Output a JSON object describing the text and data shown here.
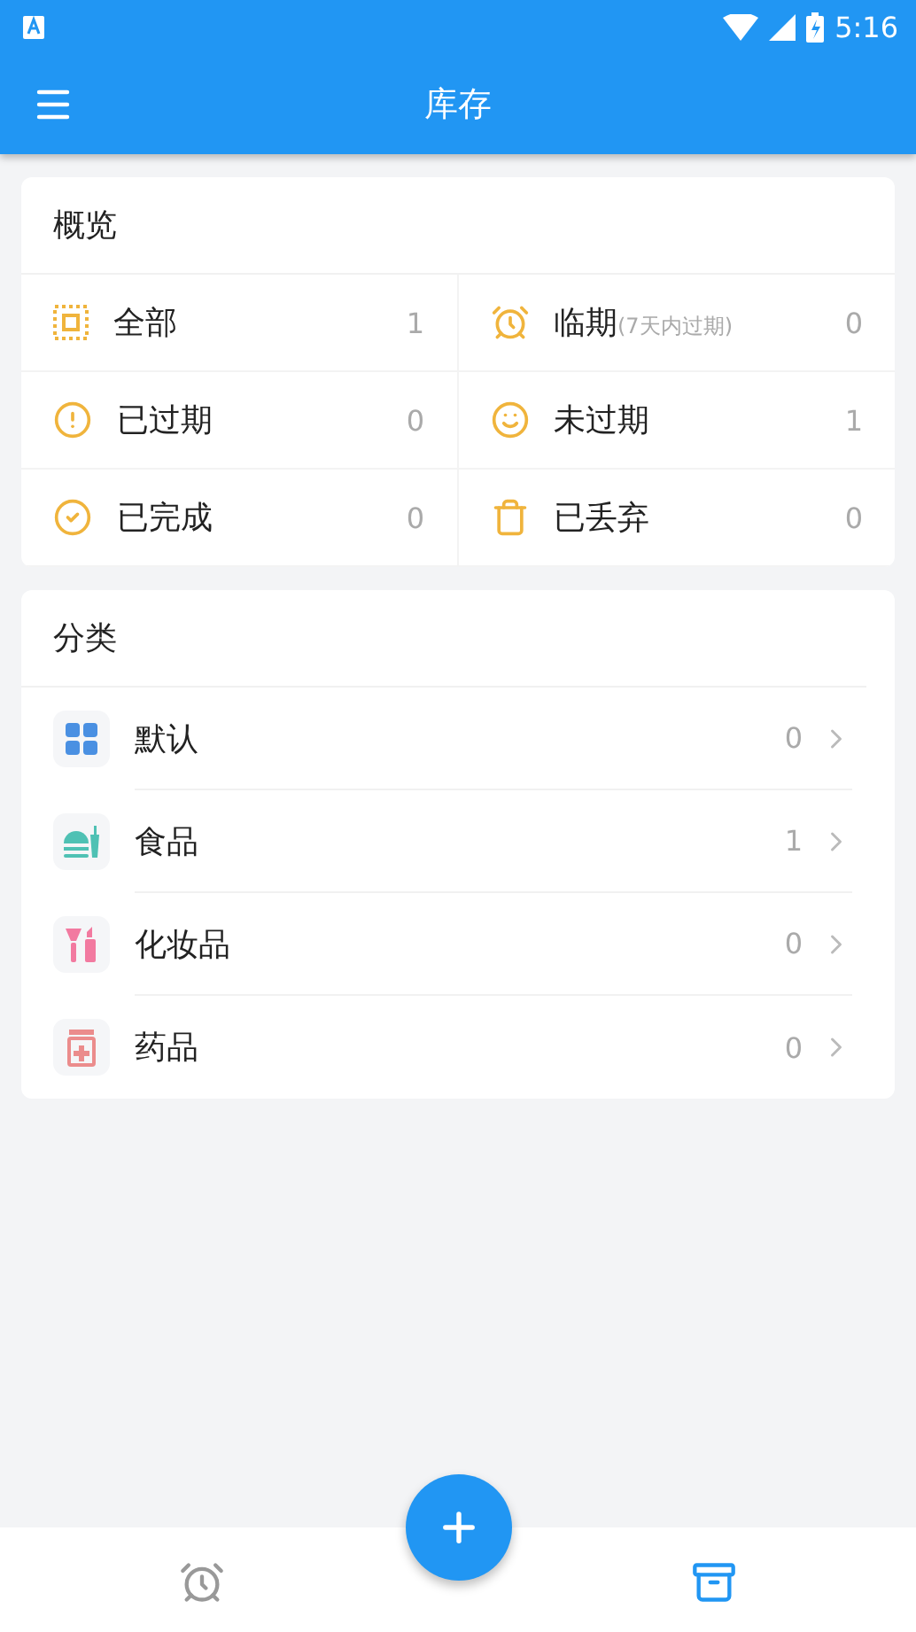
{
  "status_bar": {
    "time": "5:16"
  },
  "app_bar": {
    "title": "库存"
  },
  "overview": {
    "title": "概览",
    "items": [
      {
        "kind": "all",
        "label": "全部",
        "count": "1"
      },
      {
        "kind": "soon",
        "label": "临期",
        "note": "(7天内过期)",
        "count": "0"
      },
      {
        "kind": "expired",
        "label": "已过期",
        "count": "0"
      },
      {
        "kind": "fresh",
        "label": "未过期",
        "count": "1"
      },
      {
        "kind": "done",
        "label": "已完成",
        "count": "0"
      },
      {
        "kind": "discarded",
        "label": "已丢弃",
        "count": "0"
      }
    ]
  },
  "categories": {
    "title": "分类",
    "items": [
      {
        "kind": "grid",
        "label": "默认",
        "count": "0",
        "color": "#4a90e2"
      },
      {
        "kind": "food",
        "label": "食品",
        "count": "1",
        "color": "#4fc1b4"
      },
      {
        "kind": "cosmetics",
        "label": "化妆品",
        "count": "0",
        "color": "#f27aa0"
      },
      {
        "kind": "medicine",
        "label": "药品",
        "count": "0",
        "color": "#eb8c8c"
      }
    ]
  },
  "bottom_nav": [
    {
      "kind": "alarm",
      "selected": false
    },
    {
      "kind": "archive",
      "selected": true
    }
  ]
}
